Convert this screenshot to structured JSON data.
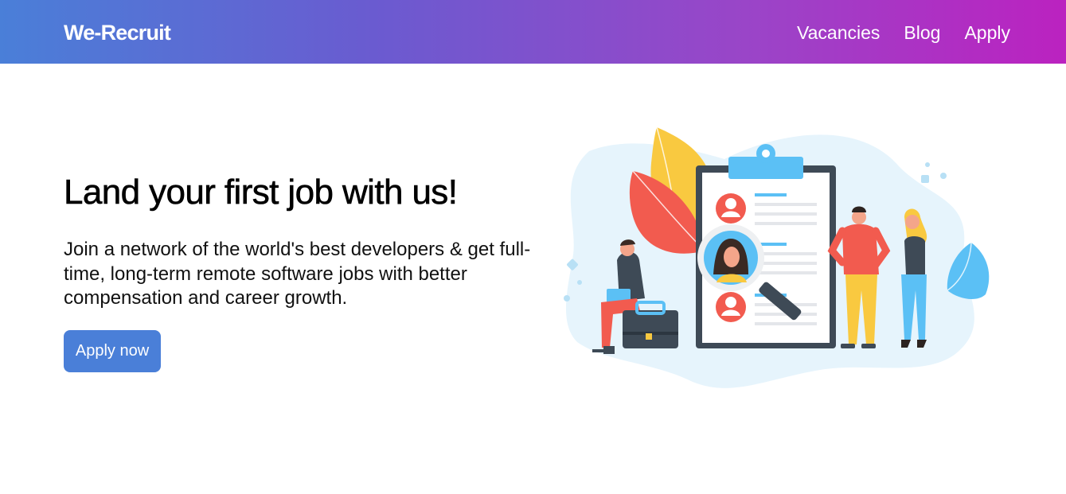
{
  "navbar": {
    "brand": "We-Recruit",
    "links": [
      "Vacancies",
      "Blog",
      "Apply"
    ]
  },
  "hero": {
    "title": "Land your first job with us!",
    "text": "Join a network of the world's best developers & get full-time, long-term remote software jobs with better compensation and career growth.",
    "button_label": "Apply now"
  },
  "colors": {
    "nav_gradient_start": "#4a7fd8",
    "nav_gradient_end": "#bb22c0",
    "button_bg": "#4a7fd8"
  }
}
